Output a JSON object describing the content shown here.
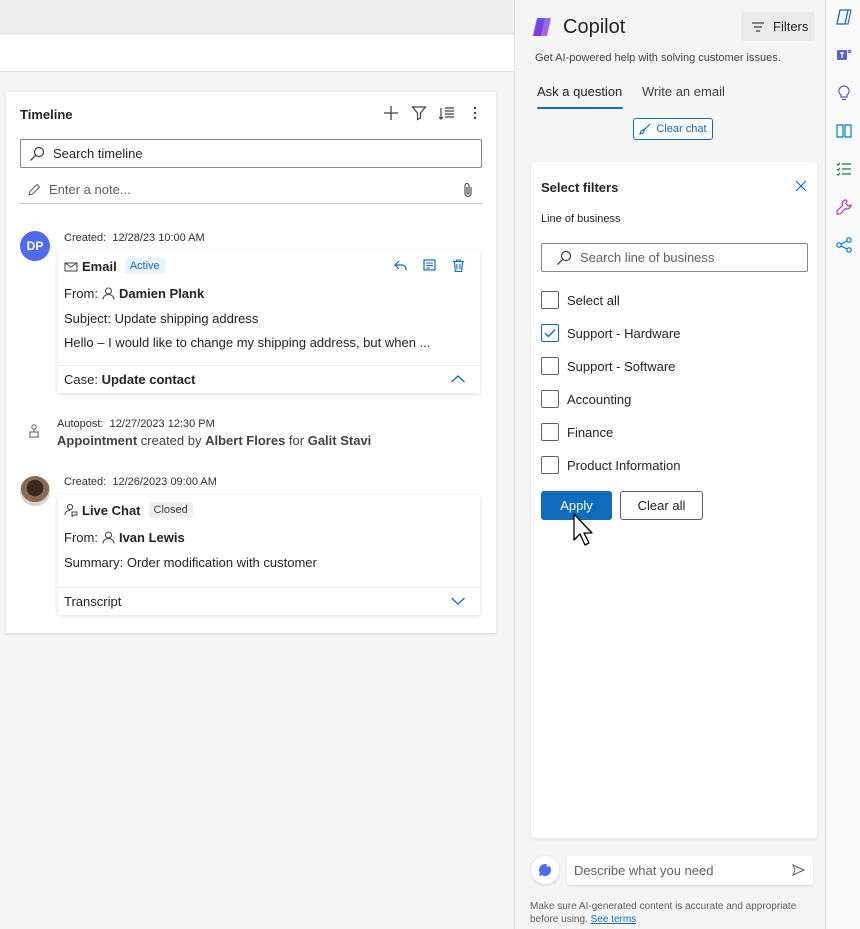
{
  "timeline": {
    "title": "Timeline",
    "search_placeholder": "Search timeline",
    "note_placeholder": "Enter a note...",
    "items": [
      {
        "avatar_initials": "DP",
        "created_label": "Created:",
        "created": "12/28/23  10:00 AM",
        "type": "Email",
        "status": "Active",
        "from_label": "From:",
        "from": "Damien Plank",
        "line1": "Subject: Update shipping address",
        "line2": "Hello – I would like to change my shipping address, but when ...",
        "footer_label": "Case:",
        "footer_value": "Update contact"
      },
      {
        "autopost_label": "Autopost:",
        "autopost_time": "12/27/2023  12:30 PM",
        "entity": "Appointment",
        "created_by_text": "created by",
        "creator": "Albert Flores",
        "for_text": "for",
        "target": "Galit Stavi"
      },
      {
        "created_label": "Created:",
        "created": "12/26/2023  09:00 AM",
        "type": "Live Chat",
        "status": "Closed",
        "from_label": "From:",
        "from": "Ivan Lewis",
        "line1": "Summary: Order modification with customer",
        "footer_value": "Transcript"
      }
    ]
  },
  "copilot": {
    "title": "Copilot",
    "filters_label": "Filters",
    "subtitle": "Get AI-powered help with solving customer issues.",
    "tabs": [
      "Ask a question",
      "Write an email"
    ],
    "clear_chat": "Clear chat",
    "filter_panel": {
      "title": "Select filters",
      "section_label": "Line of business",
      "search_placeholder": "Search line of business",
      "options": [
        {
          "label": "Select all",
          "checked": false
        },
        {
          "label": "Support - Hardware",
          "checked": true
        },
        {
          "label": "Support - Software",
          "checked": false
        },
        {
          "label": "Accounting",
          "checked": false
        },
        {
          "label": "Finance",
          "checked": false
        },
        {
          "label": "Product Information",
          "checked": false
        }
      ],
      "apply": "Apply",
      "clear_all": "Clear all"
    },
    "input_placeholder": "Describe what you need",
    "disclaimer": "Make sure AI-generated content is accurate and appropriate before using.",
    "see_terms": "See terms"
  },
  "colors": {
    "accent": "#0f6cbd",
    "avatar": "#4f6bed"
  }
}
